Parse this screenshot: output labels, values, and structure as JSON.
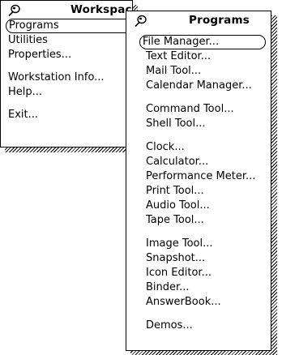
{
  "workspace_menu": {
    "title": "Workspace",
    "items": [
      {
        "label": "Programs"
      },
      {
        "label": "Utilities"
      },
      {
        "label": "Properties..."
      },
      {
        "label": "Workstation Info..."
      },
      {
        "label": "Help..."
      },
      {
        "label": "Exit..."
      }
    ]
  },
  "programs_menu": {
    "title": "Programs",
    "items": [
      {
        "label": "File Manager..."
      },
      {
        "label": "Text Editor..."
      },
      {
        "label": "Mail Tool..."
      },
      {
        "label": "Calendar Manager..."
      },
      {
        "label": "Command Tool..."
      },
      {
        "label": "Shell Tool..."
      },
      {
        "label": "Clock..."
      },
      {
        "label": "Calculator..."
      },
      {
        "label": "Performance Meter..."
      },
      {
        "label": "Print Tool..."
      },
      {
        "label": "Audio Tool..."
      },
      {
        "label": "Tape Tool..."
      },
      {
        "label": "Image Tool..."
      },
      {
        "label": "Snapshot..."
      },
      {
        "label": "Icon Editor..."
      },
      {
        "label": "Binder..."
      },
      {
        "label": "AnswerBook..."
      },
      {
        "label": "Demos..."
      }
    ]
  },
  "icons": {
    "pushpin": "pushpin-icon"
  },
  "colors": {
    "foreground": "#000000",
    "background": "#ffffff"
  }
}
